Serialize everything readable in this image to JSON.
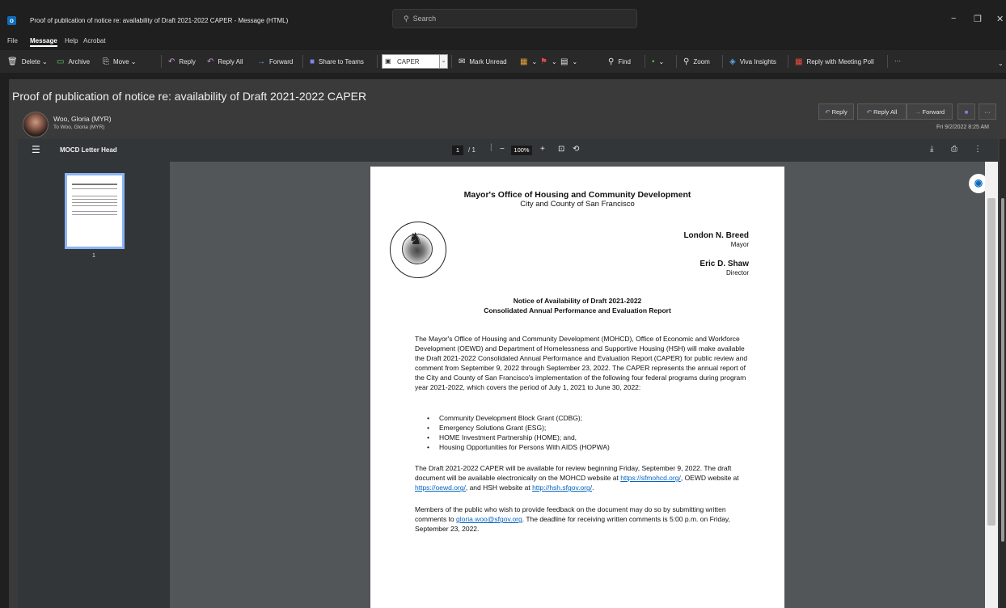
{
  "window": {
    "title": "Proof of publication of notice re: availability of Draft 2021-2022 CAPER  -  Message (HTML)",
    "search_placeholder": "Search",
    "app_icon": "outlook-icon"
  },
  "menu": [
    "File",
    "Message",
    "Help",
    "Acrobat"
  ],
  "ribbon": {
    "delete": "Delete",
    "archive": "Archive",
    "move": "Move",
    "reply": "Reply",
    "reply_all": "Reply All",
    "forward": "Forward",
    "share_teams": "Share to Teams",
    "quick_step": "CAPER",
    "mark_unread": "Mark Unread",
    "find": "Find",
    "zoom": "Zoom",
    "viva": "Viva Insights",
    "meeting_poll": "Reply with Meeting Poll",
    "more": "···"
  },
  "message": {
    "subject": "Proof of publication of notice re: availability of Draft 2021-2022 CAPER",
    "sender": "Woo, Gloria (MYR)",
    "to": "To  Woo, Gloria (MYR)",
    "date": "Fri 9/2/2022 8:25 AM",
    "reply": "Reply",
    "reply_all": "Reply All",
    "forward": "Forward",
    "more": "···"
  },
  "pdf": {
    "title": "MOCD Letter Head",
    "page_current": "1",
    "page_total": "/  1",
    "zoom": "100%",
    "thumb_label": "1"
  },
  "letter": {
    "org": "Mayor's Office of Housing and Community Development",
    "city": "City and County of San Francisco",
    "mayor_name": "London N. Breed",
    "mayor_title": "Mayor",
    "director_name": "Eric D. Shaw",
    "director_title": "Director",
    "notice_title_1": "Notice of Availability of Draft 2021-2022",
    "notice_title_2": "Consolidated Annual Performance and Evaluation Report",
    "para1": "The Mayor's Office of Housing and Community Development (MOHCD), Office of Economic and Workforce Development (OEWD) and Department of Homelessness and Supportive Housing (HSH) will make available the Draft 2021-2022 Consolidated Annual Performance and Evaluation Report (CAPER) for public review and comment from September 9, 2022 through September 23, 2022. The CAPER represents the annual report of the City and County of San Francisco's implementation of the following four federal programs during program year 2021-2022, which covers the period of July 1, 2021 to June 30, 2022:",
    "bullets": [
      "Community Development Block Grant (CDBG);",
      "Emergency Solutions Grant (ESG);",
      "HOME Investment Partnership (HOME); and,",
      "Housing Opportunities for Persons With AIDS (HOPWA)"
    ],
    "para2_a": "The Draft 2021-2022 CAPER will be available for review beginning Friday, September 9, 2022. The draft document will be available electronically on the MOHCD website at ",
    "link1": "https://sfmohcd.org/",
    "para2_b": ", OEWD website at ",
    "link2": "https://oewd.org/",
    "para2_c": ", and HSH website at ",
    "link3": "http://hsh.sfgov.org/",
    "para2_d": ".",
    "para3_a": "Members of the public who wish to provide feedback on the document may do so by submitting written comments to ",
    "link4": "gloria.woo@sfgov.org",
    "para3_b": ". The deadline for receiving written comments is 5:00 p.m. on Friday, September 23, 2022."
  }
}
